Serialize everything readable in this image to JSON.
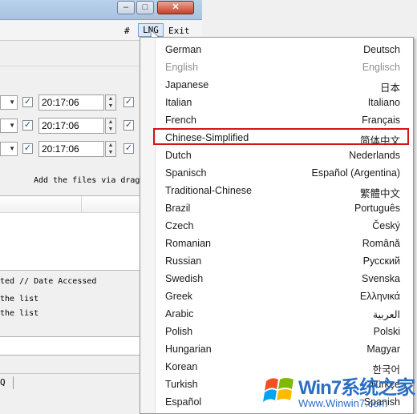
{
  "toolbar": {
    "hash": "#",
    "lng": "LNG",
    "exit": "Exit"
  },
  "time_rows": [
    "20:17:06",
    "20:17:06",
    "20:17:06"
  ],
  "drag_hint": "Add the files via drag",
  "info": {
    "columns_line": "ted     //    Date Accessed",
    "line1": "the list",
    "line2": "the list"
  },
  "status": {
    "q": "Q"
  },
  "languages": [
    {
      "name": "German",
      "native": "Deutsch"
    },
    {
      "name": "English",
      "native": "Englisch",
      "disabled": true
    },
    {
      "name": "Japanese",
      "native": "日本"
    },
    {
      "name": "Italian",
      "native": "Italiano"
    },
    {
      "name": "French",
      "native": "Français"
    },
    {
      "name": "Chinese-Simplified",
      "native": "简体中文",
      "highlighted": true
    },
    {
      "name": "Dutch",
      "native": "Nederlands"
    },
    {
      "name": "Spanisch",
      "native": "Español (Argentina)"
    },
    {
      "name": "Traditional-Chinese",
      "native": "繁體中文"
    },
    {
      "name": "Brazil",
      "native": "Português"
    },
    {
      "name": "Czech",
      "native": "Český"
    },
    {
      "name": "Romanian",
      "native": "Română"
    },
    {
      "name": "Russian",
      "native": "Русский"
    },
    {
      "name": "Swedish",
      "native": "Svenska"
    },
    {
      "name": "Greek",
      "native": "Ελληνικά"
    },
    {
      "name": "Arabic",
      "native": "العربية"
    },
    {
      "name": "Polish",
      "native": "Polski"
    },
    {
      "name": "Hungarian",
      "native": "Magyar"
    },
    {
      "name": "Korean",
      "native": "한국어"
    },
    {
      "name": "Turkish",
      "native": "Türkçe"
    },
    {
      "name": "Español",
      "native": "Spanish"
    }
  ],
  "watermark": {
    "brand": "Win7系统之家",
    "url": "Www.Winwin7.com"
  },
  "colors": {
    "highlight_border": "#d3141b",
    "watermark": "#2a6fc2"
  }
}
